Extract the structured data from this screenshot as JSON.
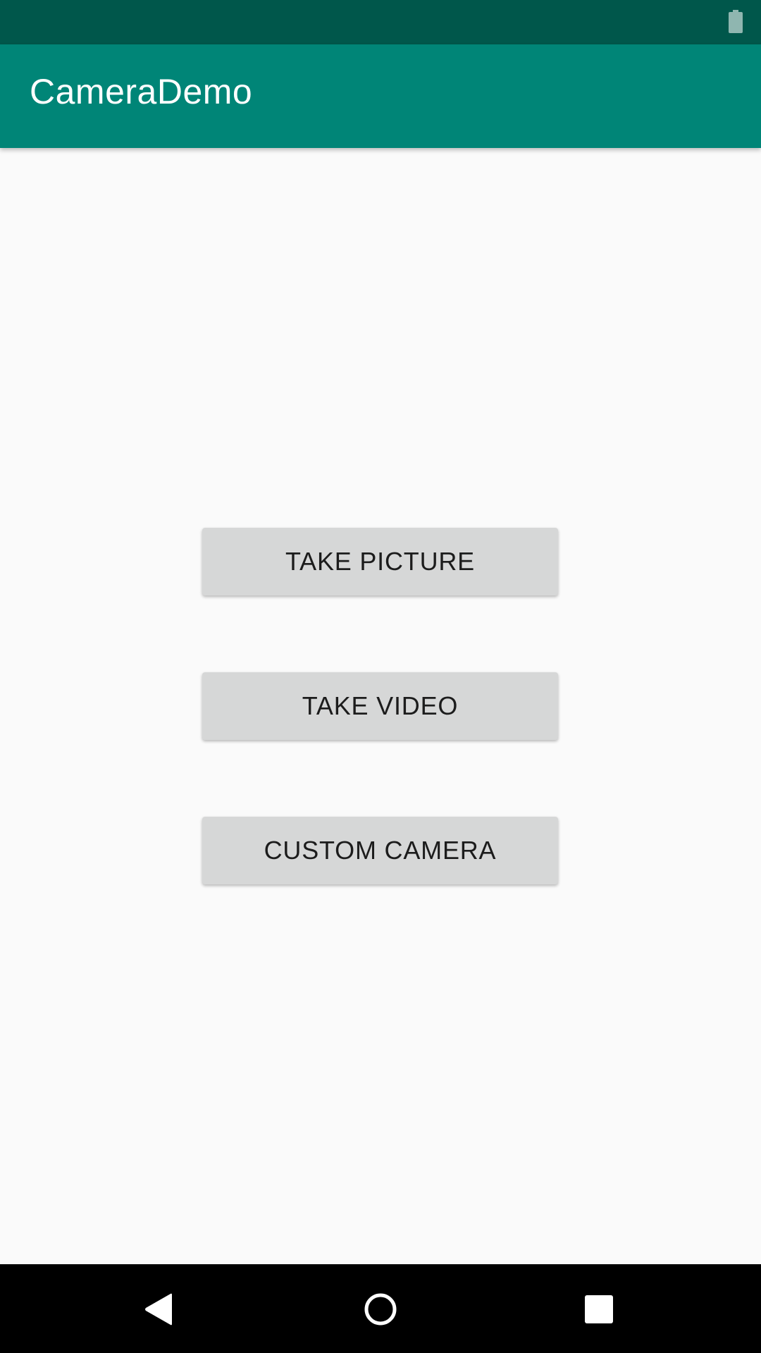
{
  "app": {
    "title": "CameraDemo"
  },
  "status_bar": {
    "icons": [
      "battery-icon"
    ],
    "color": "#00574b"
  },
  "app_bar": {
    "color": "#008577"
  },
  "buttons": [
    {
      "label": "TAKE PICTURE"
    },
    {
      "label": "TAKE VIDEO"
    },
    {
      "label": "CUSTOM CAMERA"
    }
  ],
  "nav_bar": {
    "icons": [
      "back-icon",
      "home-icon",
      "recents-icon"
    ]
  },
  "colors": {
    "background": "#fafafa",
    "button_bg": "#d6d7d7",
    "button_text": "#1c1c1c"
  }
}
